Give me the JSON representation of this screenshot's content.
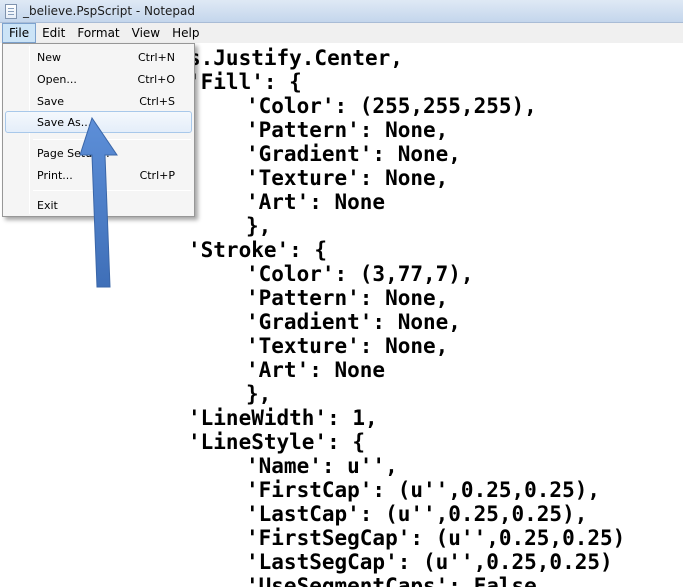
{
  "window": {
    "title": "_believe.PspScript - Notepad",
    "icon": "notepad-icon"
  },
  "menubar": {
    "items": [
      "File",
      "Edit",
      "Format",
      "View",
      "Help"
    ],
    "active": "File"
  },
  "file_menu": {
    "items": [
      {
        "label": "New",
        "shortcut": "Ctrl+N"
      },
      {
        "label": "Open...",
        "shortcut": "Ctrl+O"
      },
      {
        "label": "Save",
        "shortcut": "Ctrl+S"
      },
      {
        "label": "Save As...",
        "shortcut": ""
      },
      {
        "label": "Page Setup...",
        "shortcut": ""
      },
      {
        "label": "Print...",
        "shortcut": "Ctrl+P"
      },
      {
        "label": "Exit",
        "shortcut": ""
      }
    ],
    "highlighted": "Save As..."
  },
  "editor": {
    "lines": [
      "s.Justify.Center,",
      "'Fill': {",
      "'Color': (255,255,255),",
      "'Pattern': None,",
      "'Gradient': None,",
      "'Texture': None,",
      "'Art': None",
      "},",
      "'Stroke': {",
      "'Color': (3,77,7),",
      "'Pattern': None,",
      "'Gradient': None,",
      "'Texture': None,",
      "'Art': None",
      "},",
      "'LineWidth': 1,",
      "'LineStyle': {",
      "'Name': u'',",
      "'FirstCap': (u'',0.25,0.25),",
      "'LastCap': (u'',0.25,0.25),",
      "'FirstSegCap': (u'',0.25,0.25)",
      "'LastSegCap': (u'',0.25,0.25)",
      "'UseSegmentCaps': False"
    ]
  },
  "annotation": {
    "icon": "arrow-pointer-icon",
    "color": "#4a7dc9"
  }
}
